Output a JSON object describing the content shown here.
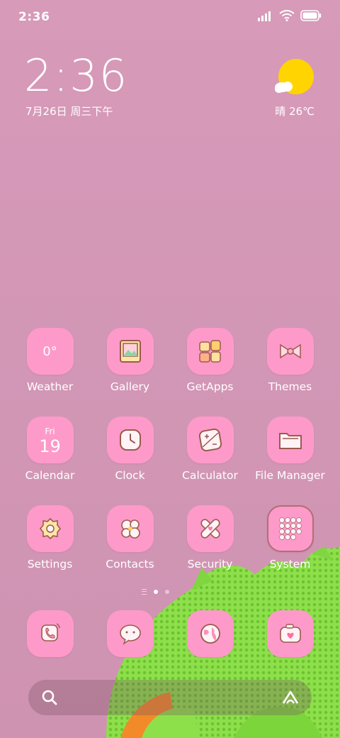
{
  "status_bar": {
    "time": "2:36",
    "icons": [
      "signal-icon",
      "wifi-icon",
      "battery-icon"
    ]
  },
  "clock_widget": {
    "time": "2:36",
    "date": "7月26日 周三下午"
  },
  "weather_widget": {
    "condition_icon": "sun-cloud-icon",
    "text": "晴 26℃"
  },
  "apps": [
    {
      "label": "Weather",
      "icon": "weather-icon",
      "icon_text": "0°"
    },
    {
      "label": "Gallery",
      "icon": "gallery-icon"
    },
    {
      "label": "GetApps",
      "icon": "getapps-icon"
    },
    {
      "label": "Themes",
      "icon": "themes-icon"
    },
    {
      "label": "Calendar",
      "icon": "calendar-icon",
      "icon_day": "Fri",
      "icon_date": "19"
    },
    {
      "label": "Clock",
      "icon": "clock-icon"
    },
    {
      "label": "Calculator",
      "icon": "calculator-icon"
    },
    {
      "label": "File Manager",
      "icon": "file-manager-icon"
    },
    {
      "label": "Settings",
      "icon": "settings-icon"
    },
    {
      "label": "Contacts",
      "icon": "contacts-icon"
    },
    {
      "label": "Security",
      "icon": "security-icon"
    },
    {
      "label": "System",
      "icon": "system-folder-icon"
    }
  ],
  "dock": [
    {
      "icon": "phone-icon"
    },
    {
      "icon": "messages-icon"
    },
    {
      "icon": "browser-icon"
    },
    {
      "icon": "camera-icon"
    }
  ],
  "page_indicator": {
    "pages": 2,
    "active": 1
  },
  "colors": {
    "accent": "#fd9ac9",
    "wallpaper": "#d49ab8",
    "icon_line": "#9c5a4c"
  }
}
